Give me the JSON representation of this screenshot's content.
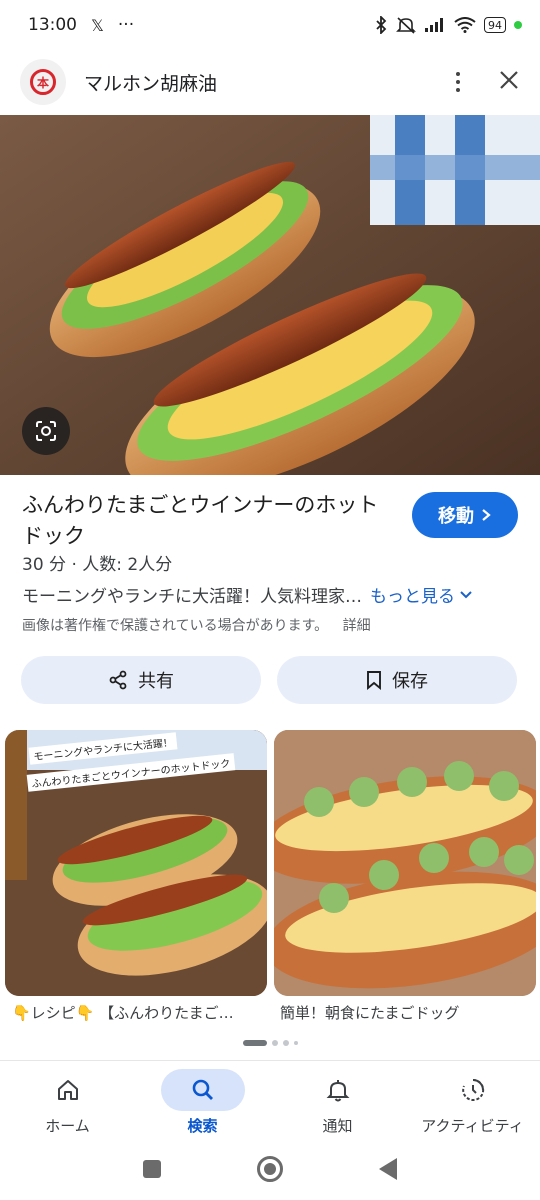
{
  "status_bar": {
    "time": "13:00",
    "x_label": "𝕏",
    "overflow": "···",
    "battery": "94"
  },
  "header": {
    "site_name": "マルホン胡麻油",
    "logo_text": "本"
  },
  "result": {
    "title": "ふんわりたまごとウインナーのホットドック",
    "visit_label": "移動",
    "meta": "30 分 · 人数: 2人分",
    "description": "モーニングやランチに大活躍！人気料理家…",
    "more_label": "もっと見る",
    "copyright": "画像は著作権で保護されている場合があります。",
    "details_label": "詳細",
    "share_label": "共有",
    "save_label": "保存"
  },
  "related": [
    {
      "caption": "👇レシピ👇 【ふんわりたまご…",
      "overlay_line1": "モーニングやランチに大活躍！",
      "overlay_line2": "ふんわりたまごとウインナーのホットドック"
    },
    {
      "caption": "簡単！朝食にたまごドッグ"
    }
  ],
  "carousel": {
    "total": 4,
    "active": 0
  },
  "bottom_nav": [
    {
      "label": "ホーム",
      "icon": "home-icon",
      "active": false
    },
    {
      "label": "検索",
      "icon": "search-icon",
      "active": true
    },
    {
      "label": "通知",
      "icon": "bell-icon",
      "active": false
    },
    {
      "label": "アクティビティ",
      "icon": "activity-icon",
      "active": false
    }
  ],
  "colors": {
    "accent": "#1a6fe0",
    "link": "#1a62c9",
    "chip": "#e8eef9",
    "nav_active_bg": "#d7e3fb"
  }
}
